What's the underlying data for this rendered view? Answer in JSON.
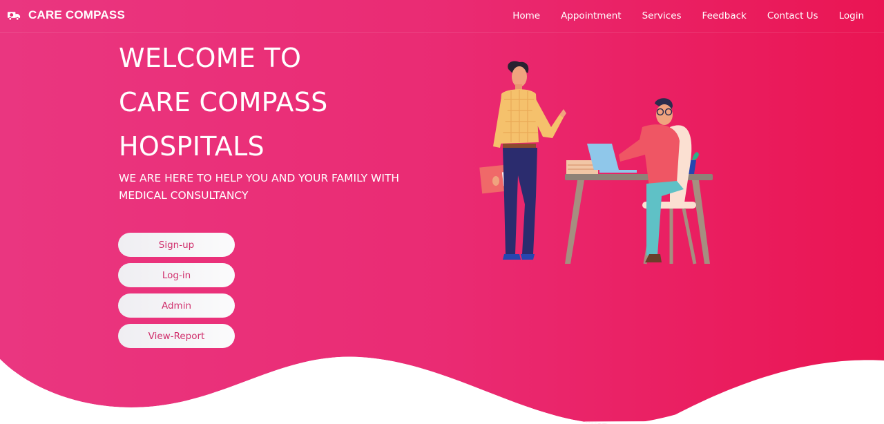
{
  "brand": {
    "name": "CARE COMPASS",
    "icon": "ambulance-icon"
  },
  "nav": {
    "items": [
      {
        "label": "Home"
      },
      {
        "label": "Appointment"
      },
      {
        "label": "Services"
      },
      {
        "label": "Feedback"
      },
      {
        "label": "Contact Us"
      },
      {
        "label": "Login"
      }
    ]
  },
  "hero": {
    "title_lines": [
      "WELCOME TO",
      "CARE COMPASS",
      "HOSPITALS"
    ],
    "subtitle": "WE ARE HERE TO HELP YOU AND YOUR FAMILY WITH MEDICAL CONSULTANCY"
  },
  "buttons": [
    {
      "label": "Sign-up"
    },
    {
      "label": "Log-in"
    },
    {
      "label": "Admin"
    },
    {
      "label": "View-Report"
    }
  ],
  "illustration": {
    "icon": "doctor-consultation-illustration"
  },
  "colors": {
    "gradient_start": "#ea3680",
    "gradient_end": "#ea1553",
    "button_text": "#d02f6c",
    "white": "#ffffff"
  }
}
